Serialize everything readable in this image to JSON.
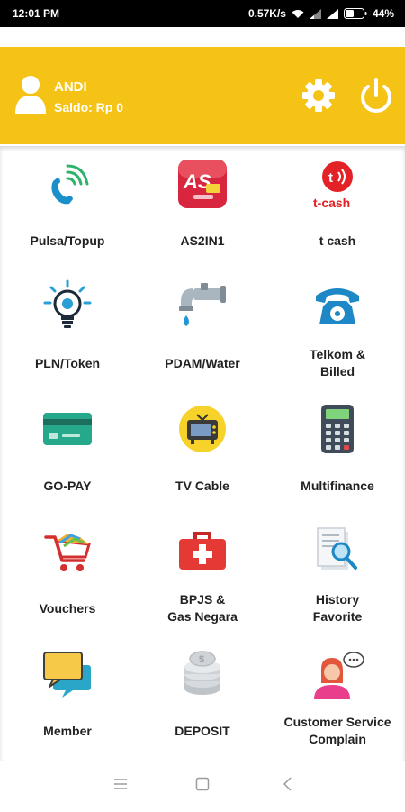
{
  "status": {
    "time": "12:01 PM",
    "speed": "0.57K/s",
    "battery": "44%"
  },
  "header": {
    "user_name": "ANDI",
    "balance": "Saldo: Rp 0",
    "accent": "#f5c316"
  },
  "menu": [
    {
      "label": "Pulsa/Topup",
      "icon": "phone-wireless-icon"
    },
    {
      "label": "AS2IN1",
      "icon": "as2in1-logo-icon"
    },
    {
      "label": "t cash",
      "icon": "tcash-logo-icon"
    },
    {
      "label": "PLN/Token",
      "icon": "lightbulb-icon"
    },
    {
      "label": "PDAM/Water",
      "icon": "water-tap-icon"
    },
    {
      "label": "Telkom &",
      "label2": "Billed",
      "icon": "telephone-icon"
    },
    {
      "label": "GO-PAY",
      "icon": "credit-card-icon"
    },
    {
      "label": "TV Cable",
      "icon": "tv-icon"
    },
    {
      "label": "Multifinance",
      "icon": "calculator-icon"
    },
    {
      "label": "Vouchers",
      "icon": "shopping-cart-icon"
    },
    {
      "label": "BPJS &",
      "label2": "Gas Negara",
      "icon": "first-aid-kit-icon"
    },
    {
      "label": "History",
      "label2": "Favorite",
      "icon": "document-search-icon"
    },
    {
      "label": "Member",
      "icon": "chat-bubbles-icon"
    },
    {
      "label": "DEPOSIT",
      "icon": "coins-icon"
    },
    {
      "label": "Customer Service",
      "label2": "Complain",
      "icon": "customer-service-icon"
    }
  ]
}
